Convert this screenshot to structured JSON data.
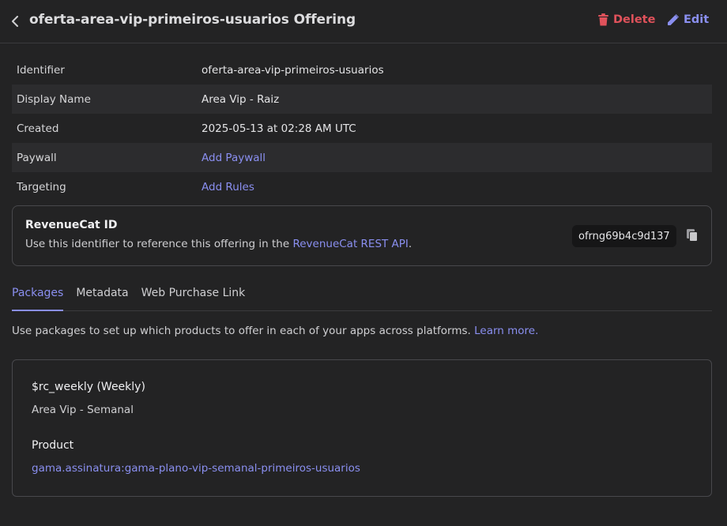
{
  "header": {
    "title": "oferta-area-vip-primeiros-usuarios Offering",
    "delete_label": "Delete",
    "edit_label": "Edit"
  },
  "details": {
    "rows": [
      {
        "label": "Identifier",
        "value": "oferta-area-vip-primeiros-usuarios"
      },
      {
        "label": "Display Name",
        "value": "Area Vip - Raiz"
      },
      {
        "label": "Created",
        "value": "2025-05-13 at 02:28 AM UTC"
      },
      {
        "label": "Paywall",
        "value": "Add Paywall"
      },
      {
        "label": "Targeting",
        "value": "Add Rules"
      }
    ]
  },
  "revenuecat": {
    "title": "RevenueCat ID",
    "description_prefix": "Use this identifier to reference this offering in the ",
    "link_text": "RevenueCat REST API",
    "description_suffix": ".",
    "id_value": "ofrng69b4c9d137"
  },
  "tabs": [
    "Packages",
    "Metadata",
    "Web Purchase Link"
  ],
  "packages": {
    "description": "Use packages to set up which products to offer in each of your apps across platforms. ",
    "learn_more": "Learn more.",
    "items": [
      {
        "name": "$rc_weekly (Weekly)",
        "subtitle": "Area Vip - Semanal",
        "product_label": "Product",
        "product_value": "gama.assinatura:gama-plano-vip-semanal-primeiros-usuarios"
      }
    ]
  },
  "colors": {
    "background": "#232324",
    "accent": "#8a8ff0",
    "danger": "#e0525b"
  },
  "icons": [
    "chevron-left-icon",
    "trash-icon",
    "pencil-icon",
    "copy-icon"
  ]
}
